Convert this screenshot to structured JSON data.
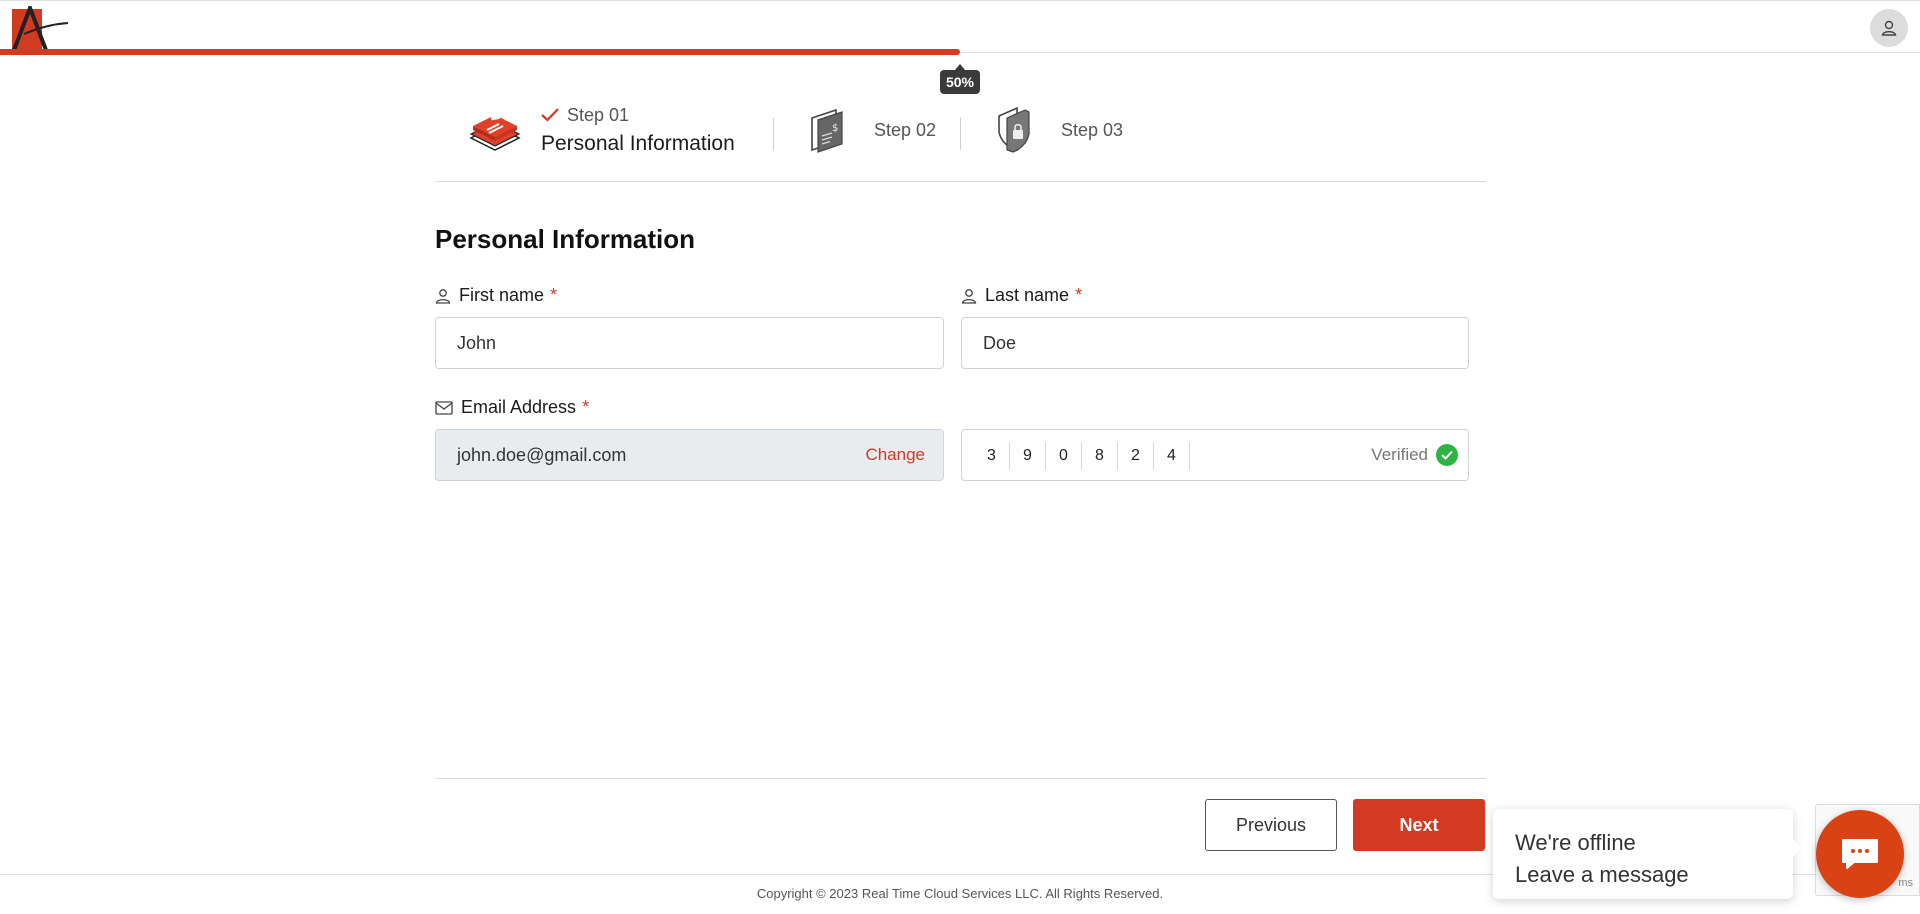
{
  "header": {
    "progress": {
      "percent": 50,
      "label": "50%"
    },
    "accent_color": "#d23a22"
  },
  "steps": [
    {
      "label": "Step 01",
      "name": "Personal Information",
      "completed": true,
      "icon": "id-card-icon"
    },
    {
      "label": "Step 02",
      "icon": "payment-card-icon"
    },
    {
      "label": "Step 03",
      "icon": "security-shield-icon"
    }
  ],
  "form": {
    "title": "Personal Information",
    "first_name": {
      "label": "First name",
      "required_mark": "*",
      "value": "John"
    },
    "last_name": {
      "label": "Last name",
      "required_mark": "*",
      "value": "Doe"
    },
    "email": {
      "label": "Email Address",
      "required_mark": "*",
      "value": "john.doe@gmail.com",
      "change_label": "Change"
    },
    "otp": {
      "digits": [
        "3",
        "9",
        "0",
        "8",
        "2",
        "4"
      ],
      "status": "Verified"
    }
  },
  "buttons": {
    "previous": "Previous",
    "next": "Next"
  },
  "footer": {
    "copyright": "Copyright © 2023 Real Time Cloud Services LLC. All Rights Reserved."
  },
  "chat": {
    "line1": "We're offline",
    "line2": "Leave a message"
  },
  "recaptcha": {
    "text": "ms"
  }
}
